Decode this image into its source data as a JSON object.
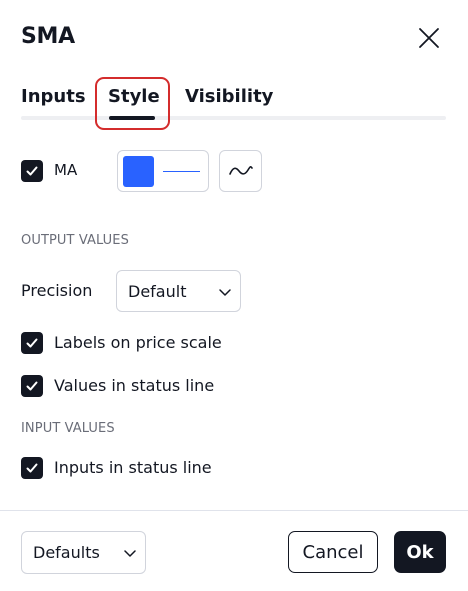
{
  "dialog": {
    "title": "SMA"
  },
  "tabs": [
    {
      "label": "Inputs",
      "active": false
    },
    {
      "label": "Style",
      "active": true
    },
    {
      "label": "Visibility",
      "active": false
    }
  ],
  "style": {
    "ma": {
      "label": "MA",
      "checked": true,
      "color": "#2962ff",
      "line_style": "line-icon"
    }
  },
  "output_values": {
    "section_label": "OUTPUT VALUES",
    "precision_label": "Precision",
    "precision_value": "Default",
    "labels_on_price_scale": {
      "label": "Labels on price scale",
      "checked": true
    },
    "values_in_status_line": {
      "label": "Values in status line",
      "checked": true
    }
  },
  "input_values": {
    "section_label": "INPUT VALUES",
    "inputs_in_status_line": {
      "label": "Inputs in status line",
      "checked": true
    }
  },
  "footer": {
    "defaults_label": "Defaults",
    "cancel_label": "Cancel",
    "ok_label": "Ok"
  },
  "colors": {
    "accent": "#2962ff",
    "primary": "#131722",
    "highlight": "#d42c2c"
  }
}
